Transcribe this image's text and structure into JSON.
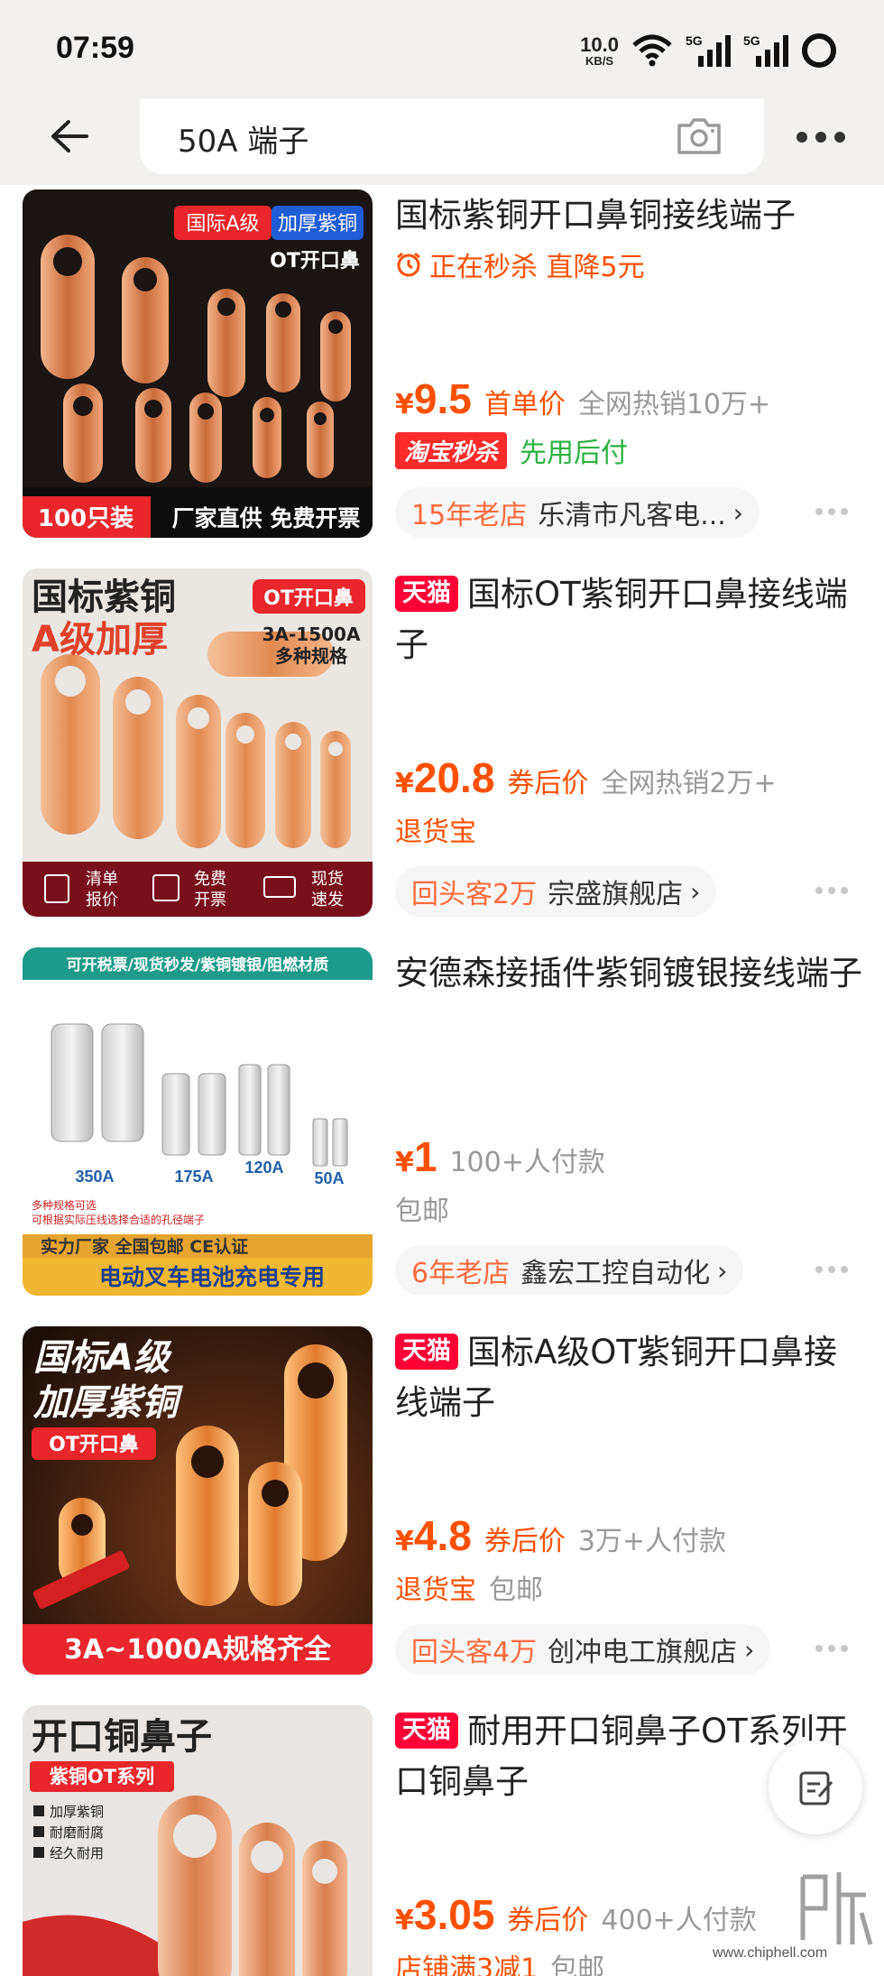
{
  "status_bar": {
    "time": "07:59",
    "net_speed_value": "10.0",
    "net_speed_unit": "KB/S",
    "signal_labels": [
      "5G",
      "5G"
    ]
  },
  "search": {
    "query": "50A 端子"
  },
  "products": [
    {
      "title": "国标紫铜开口鼻铜接线端子",
      "tmall": false,
      "flash": "正在秒杀  直降5元",
      "price": "9.5",
      "price_label": "首单价",
      "sales": "全网热销10万+",
      "tags": [
        {
          "text": "淘宝秒杀",
          "style": "tb-miaosha"
        },
        {
          "text": "先用后付",
          "style": "green"
        }
      ],
      "shop_label": "15年老店",
      "shop_name": "乐清市凡客电...",
      "image_text": {
        "badge1": "国际A级",
        "badge2": "加厚紫铜",
        "subtitle": "OT开口鼻",
        "bottom_left": "100只装",
        "bottom_right": "厂家直供 免费开票"
      }
    },
    {
      "title": "国标OT紫铜开口鼻接线端子",
      "tmall": true,
      "tmall_label": "天猫",
      "price": "20.8",
      "price_label": "券后价",
      "sales": "全网热销2万+",
      "tags": [
        {
          "text": "退货宝",
          "style": "orange"
        }
      ],
      "shop_label": "回头客2万",
      "shop_name": "宗盛旗舰店",
      "image_text": {
        "headline1": "国标紫铜",
        "headline2": "A级加厚",
        "badge": "OT开口鼻",
        "spec1": "3A-1500A",
        "spec2": "多种规格",
        "feat1a": "清单",
        "feat1b": "报价",
        "feat2a": "免费",
        "feat2b": "开票",
        "feat3a": "现货",
        "feat3b": "速发"
      }
    },
    {
      "title": "安德森接插件紫铜镀银接线端子",
      "tmall": false,
      "price": "1",
      "price_label": "",
      "sales": "100+人付款",
      "tags": [
        {
          "text": "包邮",
          "style": "gray"
        }
      ],
      "shop_label": "6年老店",
      "shop_name": "鑫宏工控自动化",
      "image_text": {
        "top": "可开税票/现货秒发/紫铜镀银/阻燃材质",
        "l1": "350A",
        "l2": "175A",
        "l3": "120A",
        "l4": "50A",
        "note1": "多种规格可选",
        "note2": "可根据实际压线选择合适的孔径端子",
        "band1": "实力厂家  全国包邮  CE认证",
        "band2": "电动叉车电池充电专用"
      }
    },
    {
      "title": "国标A级OT紫铜开口鼻接线端子",
      "tmall": true,
      "tmall_label": "天猫",
      "price": "4.8",
      "price_label": "券后价",
      "sales": "3万+人付款",
      "tags": [
        {
          "text": "退货宝",
          "style": "orange"
        },
        {
          "text": "包邮",
          "style": "gray"
        }
      ],
      "shop_label": "回头客4万",
      "shop_name": "创冲电工旗舰店",
      "image_text": {
        "h1": "国标A级",
        "h2": "加厚紫铜",
        "badge": "OT开口鼻",
        "bottom": "3A~1000A规格齐全"
      }
    },
    {
      "title": "耐用开口铜鼻子OT系列开口铜鼻子",
      "tmall": true,
      "tmall_label": "天猫",
      "price": "3.05",
      "price_label": "券后价",
      "sales": "400+人付款",
      "tags": [
        {
          "text": "店铺满3减1",
          "style": "orange"
        },
        {
          "text": "包邮",
          "style": "gray"
        }
      ],
      "shop_label": "",
      "shop_name": "",
      "image_text": {
        "h1": "开口铜鼻子",
        "badge": "紫铜OT系列",
        "f1": "加厚紫铜",
        "f2": "耐磨耐腐",
        "f3": "经久耐用"
      }
    }
  ],
  "watermark": {
    "text": "www.chiphell.com"
  },
  "colors": {
    "accent": "#ff5000",
    "tmall": "#ff0036",
    "green": "#2bb341",
    "copper": "#d9895a"
  }
}
